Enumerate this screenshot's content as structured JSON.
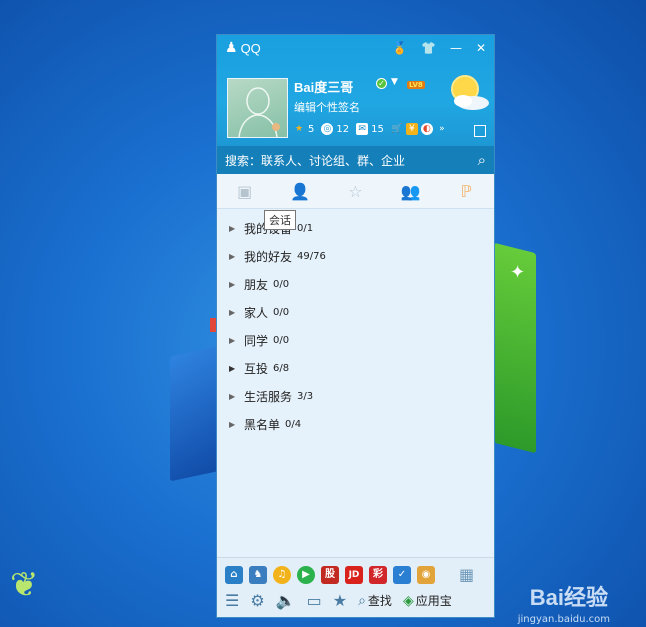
{
  "app": {
    "title": "QQ"
  },
  "profile": {
    "nickname": "Bai度三哥",
    "signature": "编辑个性签名",
    "level": "LV8",
    "stats": [
      {
        "icon": "star-icon",
        "value": "5",
        "color": "#f0b221"
      },
      {
        "icon": "qzone-icon",
        "value": "12",
        "color": "#1c9ad8"
      },
      {
        "icon": "mail-icon",
        "value": "15",
        "color": "#ffffff"
      }
    ]
  },
  "search": {
    "placeholder": "搜索：联系人、讨论组、群、企业"
  },
  "tabs": {
    "tooltip": "会话"
  },
  "groups": [
    {
      "name": "我的设备",
      "count": "0/1"
    },
    {
      "name": "我的好友",
      "count": "49/76"
    },
    {
      "name": "朋友",
      "count": "0/0"
    },
    {
      "name": "家人",
      "count": "0/0"
    },
    {
      "name": "同学",
      "count": "0/0"
    },
    {
      "name": "互投",
      "count": "6/8"
    },
    {
      "name": "生活服务",
      "count": "3/3"
    },
    {
      "name": "黑名单",
      "count": "0/4"
    }
  ],
  "bottom": {
    "apps": [
      {
        "icon": "graduation-cap-icon",
        "glyph": "🎓",
        "color": "#2a80c7"
      },
      {
        "icon": "penguin-icon",
        "glyph": "♞",
        "color": "#3a7ebf"
      },
      {
        "icon": "qqmusic-icon",
        "glyph": "♫",
        "color": "#f2b21a"
      },
      {
        "icon": "video-icon",
        "glyph": "▶",
        "color": "#2bb24c"
      },
      {
        "icon": "stock-icon",
        "glyph": "股",
        "color": "#c22a21"
      },
      {
        "icon": "jd-icon",
        "glyph": "JD",
        "color": "#d9221c"
      },
      {
        "icon": "lottery-icon",
        "glyph": "彩",
        "color": "#d1262a"
      },
      {
        "icon": "shield-icon",
        "glyph": "✓",
        "color": "#2b7fd2"
      },
      {
        "icon": "pet-icon",
        "glyph": "◉",
        "color": "#e2a33a"
      }
    ],
    "find_label": "查找",
    "appstore_label": "应用宝"
  },
  "watermark": {
    "text": "Bai经验",
    "url": "jingyan.baidu.com"
  }
}
